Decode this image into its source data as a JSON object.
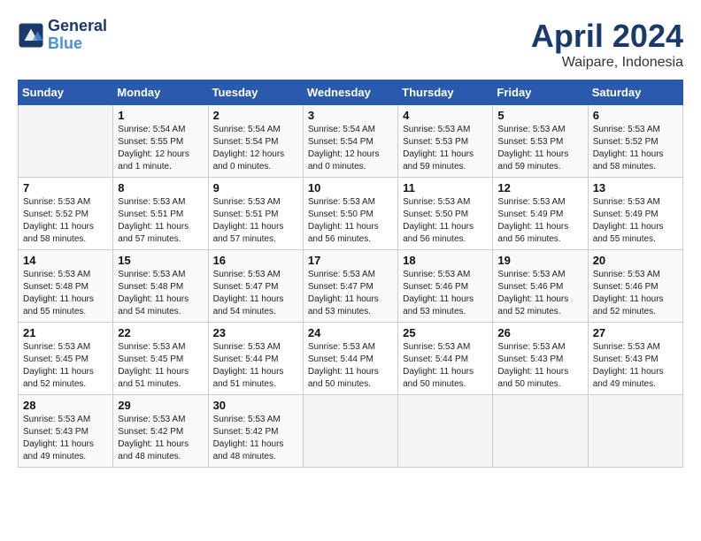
{
  "header": {
    "logo_line1": "General",
    "logo_line2": "Blue",
    "month_title": "April 2024",
    "location": "Waipare, Indonesia"
  },
  "days_of_week": [
    "Sunday",
    "Monday",
    "Tuesday",
    "Wednesday",
    "Thursday",
    "Friday",
    "Saturday"
  ],
  "weeks": [
    [
      {
        "day": "",
        "info": ""
      },
      {
        "day": "1",
        "info": "Sunrise: 5:54 AM\nSunset: 5:55 PM\nDaylight: 12 hours\nand 1 minute."
      },
      {
        "day": "2",
        "info": "Sunrise: 5:54 AM\nSunset: 5:54 PM\nDaylight: 12 hours\nand 0 minutes."
      },
      {
        "day": "3",
        "info": "Sunrise: 5:54 AM\nSunset: 5:54 PM\nDaylight: 12 hours\nand 0 minutes."
      },
      {
        "day": "4",
        "info": "Sunrise: 5:53 AM\nSunset: 5:53 PM\nDaylight: 11 hours\nand 59 minutes."
      },
      {
        "day": "5",
        "info": "Sunrise: 5:53 AM\nSunset: 5:53 PM\nDaylight: 11 hours\nand 59 minutes."
      },
      {
        "day": "6",
        "info": "Sunrise: 5:53 AM\nSunset: 5:52 PM\nDaylight: 11 hours\nand 58 minutes."
      }
    ],
    [
      {
        "day": "7",
        "info": "Sunrise: 5:53 AM\nSunset: 5:52 PM\nDaylight: 11 hours\nand 58 minutes."
      },
      {
        "day": "8",
        "info": "Sunrise: 5:53 AM\nSunset: 5:51 PM\nDaylight: 11 hours\nand 57 minutes."
      },
      {
        "day": "9",
        "info": "Sunrise: 5:53 AM\nSunset: 5:51 PM\nDaylight: 11 hours\nand 57 minutes."
      },
      {
        "day": "10",
        "info": "Sunrise: 5:53 AM\nSunset: 5:50 PM\nDaylight: 11 hours\nand 56 minutes."
      },
      {
        "day": "11",
        "info": "Sunrise: 5:53 AM\nSunset: 5:50 PM\nDaylight: 11 hours\nand 56 minutes."
      },
      {
        "day": "12",
        "info": "Sunrise: 5:53 AM\nSunset: 5:49 PM\nDaylight: 11 hours\nand 56 minutes."
      },
      {
        "day": "13",
        "info": "Sunrise: 5:53 AM\nSunset: 5:49 PM\nDaylight: 11 hours\nand 55 minutes."
      }
    ],
    [
      {
        "day": "14",
        "info": "Sunrise: 5:53 AM\nSunset: 5:48 PM\nDaylight: 11 hours\nand 55 minutes."
      },
      {
        "day": "15",
        "info": "Sunrise: 5:53 AM\nSunset: 5:48 PM\nDaylight: 11 hours\nand 54 minutes."
      },
      {
        "day": "16",
        "info": "Sunrise: 5:53 AM\nSunset: 5:47 PM\nDaylight: 11 hours\nand 54 minutes."
      },
      {
        "day": "17",
        "info": "Sunrise: 5:53 AM\nSunset: 5:47 PM\nDaylight: 11 hours\nand 53 minutes."
      },
      {
        "day": "18",
        "info": "Sunrise: 5:53 AM\nSunset: 5:46 PM\nDaylight: 11 hours\nand 53 minutes."
      },
      {
        "day": "19",
        "info": "Sunrise: 5:53 AM\nSunset: 5:46 PM\nDaylight: 11 hours\nand 52 minutes."
      },
      {
        "day": "20",
        "info": "Sunrise: 5:53 AM\nSunset: 5:46 PM\nDaylight: 11 hours\nand 52 minutes."
      }
    ],
    [
      {
        "day": "21",
        "info": "Sunrise: 5:53 AM\nSunset: 5:45 PM\nDaylight: 11 hours\nand 52 minutes."
      },
      {
        "day": "22",
        "info": "Sunrise: 5:53 AM\nSunset: 5:45 PM\nDaylight: 11 hours\nand 51 minutes."
      },
      {
        "day": "23",
        "info": "Sunrise: 5:53 AM\nSunset: 5:44 PM\nDaylight: 11 hours\nand 51 minutes."
      },
      {
        "day": "24",
        "info": "Sunrise: 5:53 AM\nSunset: 5:44 PM\nDaylight: 11 hours\nand 50 minutes."
      },
      {
        "day": "25",
        "info": "Sunrise: 5:53 AM\nSunset: 5:44 PM\nDaylight: 11 hours\nand 50 minutes."
      },
      {
        "day": "26",
        "info": "Sunrise: 5:53 AM\nSunset: 5:43 PM\nDaylight: 11 hours\nand 50 minutes."
      },
      {
        "day": "27",
        "info": "Sunrise: 5:53 AM\nSunset: 5:43 PM\nDaylight: 11 hours\nand 49 minutes."
      }
    ],
    [
      {
        "day": "28",
        "info": "Sunrise: 5:53 AM\nSunset: 5:43 PM\nDaylight: 11 hours\nand 49 minutes."
      },
      {
        "day": "29",
        "info": "Sunrise: 5:53 AM\nSunset: 5:42 PM\nDaylight: 11 hours\nand 48 minutes."
      },
      {
        "day": "30",
        "info": "Sunrise: 5:53 AM\nSunset: 5:42 PM\nDaylight: 11 hours\nand 48 minutes."
      },
      {
        "day": "",
        "info": ""
      },
      {
        "day": "",
        "info": ""
      },
      {
        "day": "",
        "info": ""
      },
      {
        "day": "",
        "info": ""
      }
    ]
  ]
}
